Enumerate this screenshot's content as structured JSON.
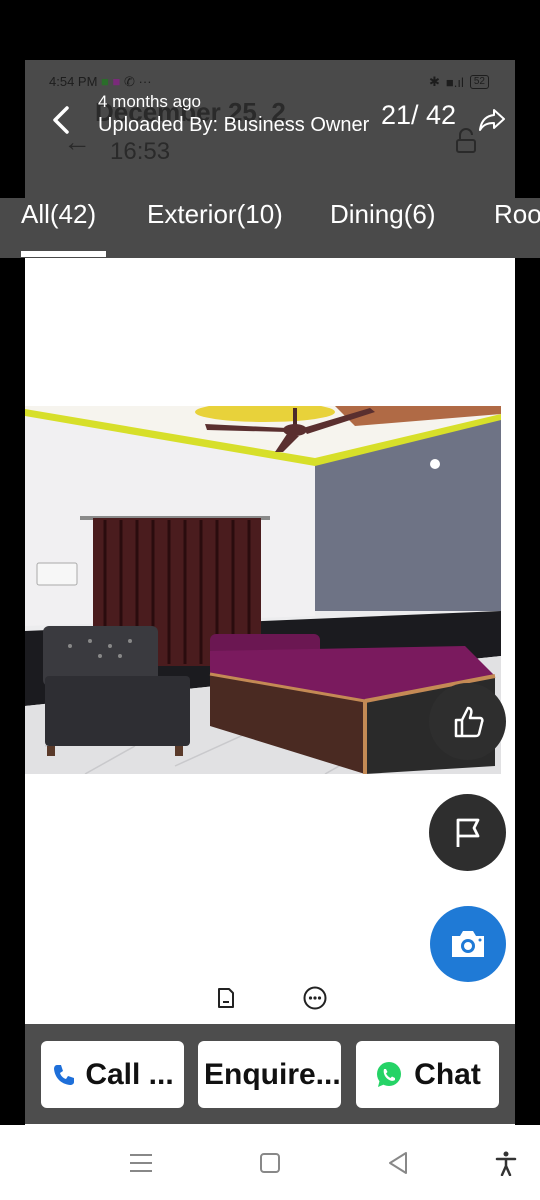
{
  "status_bar": {
    "time": "4:54 PM",
    "dots": "···",
    "battery": "52"
  },
  "ghost_overlay": {
    "date": "December 25, 2",
    "time": "16:53"
  },
  "header": {
    "age": "4 months ago",
    "uploader": "Uploaded By: Business Owner",
    "counter": "21/ 42"
  },
  "tabs": [
    {
      "label": "All(42)"
    },
    {
      "label": "Exterior(10)"
    },
    {
      "label": "Dining(6)"
    },
    {
      "label": "Roo"
    }
  ],
  "actions": {
    "call": "Call ...",
    "enquire": "Enquire...",
    "chat": "Chat"
  },
  "colors": {
    "topbar": "#4a4a4a",
    "camera_fab": "#1f7ad6",
    "call_icon": "#1e6fd9",
    "whatsapp": "#25d366"
  },
  "icons": [
    "back-icon",
    "share-icon",
    "like-icon",
    "flag-icon",
    "camera-icon",
    "document-icon",
    "more-icon",
    "phone-icon",
    "whatsapp-icon",
    "menu-icon",
    "home-icon",
    "back-nav-icon",
    "accessibility-icon"
  ]
}
